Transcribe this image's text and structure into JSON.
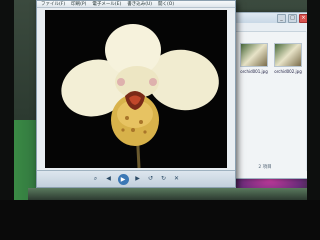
{
  "viewer": {
    "menu": [
      "ファイル(F)",
      "印刷(P)",
      "電子メール(E)",
      "書き込み(U)",
      "開く(O)"
    ],
    "toolbar": [
      "search-icon",
      "prev-icon",
      "play-icon",
      "next-icon",
      "rotate-left-icon",
      "rotate-right-icon",
      "delete-icon"
    ],
    "photo_subject": "orchid"
  },
  "explorer": {
    "thumbnails": [
      {
        "caption": "orchid001.jpg"
      },
      {
        "caption": "orchid002.jpg"
      }
    ],
    "status": "2 項目"
  },
  "colors": {
    "petal": "#f3efd6",
    "lip": "#d8b24a",
    "accent": "#3b78b5"
  }
}
